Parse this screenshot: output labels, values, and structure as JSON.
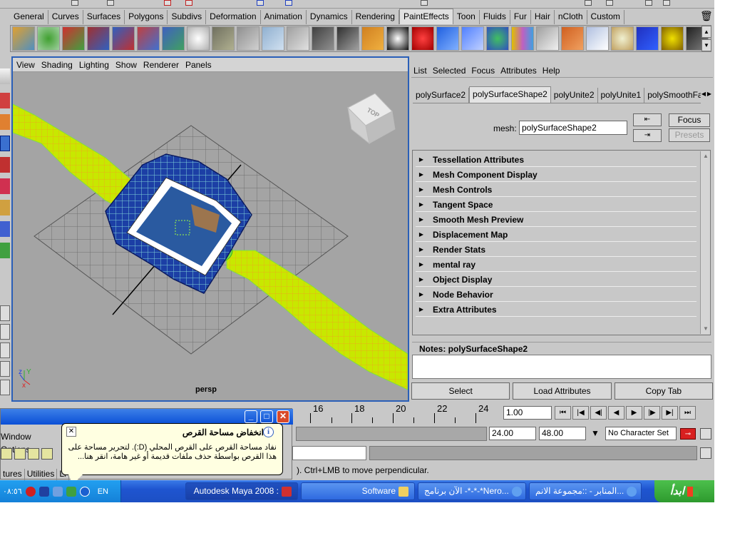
{
  "shelf": {
    "tabs": [
      "General",
      "Curves",
      "Surfaces",
      "Polygons",
      "Subdivs",
      "Deformation",
      "Animation",
      "Dynamics",
      "Rendering",
      "PaintEffects",
      "Toon",
      "Fluids",
      "Fur",
      "Hair",
      "nCloth",
      "Custom"
    ],
    "active_tab": "PaintEffects"
  },
  "viewport": {
    "menu": [
      "View",
      "Shading",
      "Lighting",
      "Show",
      "Renderer",
      "Panels"
    ],
    "camera_label": "persp",
    "viewcube_label": "TOP",
    "axis_z": "z",
    "axis_y": "Y",
    "axis_x": "x"
  },
  "attribute_editor": {
    "menu": [
      "List",
      "Selected",
      "Focus",
      "Attributes",
      "Help"
    ],
    "tabs": [
      "polySurface2",
      "polySurfaceShape2",
      "polyUnite2",
      "polyUnite1",
      "polySmoothFace"
    ],
    "active_tab": "polySurfaceShape2",
    "mesh_label": "mesh:",
    "mesh_value": "polySurfaceShape2",
    "focus_label": "Focus",
    "presets_label": "Presets",
    "sections": [
      "Tessellation Attributes",
      "Mesh Component Display",
      "Mesh Controls",
      "Tangent Space",
      "Smooth Mesh Preview",
      "Displacement Map",
      "Render Stats",
      "mental ray",
      "Object Display",
      "Node Behavior",
      "Extra Attributes"
    ],
    "notes_label": "Notes:  polySurfaceShape2",
    "buttons": [
      "Select",
      "Load Attributes",
      "Copy Tab"
    ]
  },
  "timeline": {
    "ticks": [
      "16",
      "18",
      "20",
      "22",
      "24"
    ],
    "current_frame": "1.00"
  },
  "range": {
    "start": "24.00",
    "end": "48.00",
    "character_set": "No Character Set"
  },
  "help_line": "). Ctrl+LMB to move perpendicular.",
  "float_window": {
    "menu": [
      "Window",
      "Options"
    ],
    "tabs": [
      "tures",
      "Utilities",
      "Li"
    ]
  },
  "balloon": {
    "title": "انخفاض مساحة القرص",
    "body": "نفاد مساحة القرص على القرص المحلي (D:). لتحرير مساحة على هذا القرص بواسطة حذف ملفات قديمة أو غير هامة، انقر هنا..."
  },
  "taskbar": {
    "clock": "٠٨:٥٦",
    "lang": "EN",
    "buttons": [
      "Autodesk Maya 2008 :",
      "Software",
      "الآن برنامج -*-*-*Nero...",
      "المنابر - ::مجموعة الانم..."
    ],
    "start_label": "ابدأ"
  },
  "colors": {
    "accent": "#2a5fb8",
    "mesh_blue": "#1a3f9a",
    "plane_yellow": "#c8e800",
    "taskbar": "#245edb",
    "start_green": "#3aa83a"
  }
}
